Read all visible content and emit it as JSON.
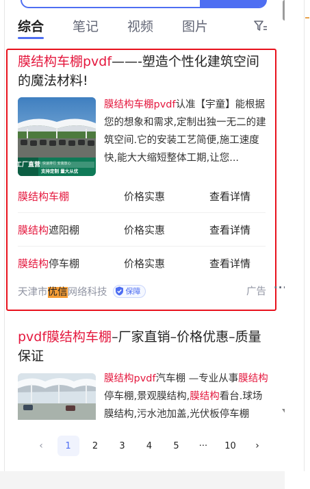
{
  "tabs": [
    {
      "label": "综合",
      "active": true
    },
    {
      "label": "笔记",
      "active": false
    },
    {
      "label": "视频",
      "active": false
    },
    {
      "label": "图片",
      "active": false
    }
  ],
  "ad": {
    "title_hl": "膜结构车棚pvdf",
    "title_rest": "——-塑造个性化建筑空间的魔法材料!",
    "thumb_banner_big": "工厂直营",
    "thumb_banner_small_1": "快速排行 安装放心",
    "thumb_banner_small_2": "支持定制 量大从优",
    "desc_hl": "膜结构车棚pvdf",
    "desc_rest": "认准【宇童】能根据您的想象和需求,定制出独一无二的建筑空间.它的安装工艺简便,施工速度快,能大大缩短整体工期,让您...",
    "rows": [
      {
        "c1_hl": "膜结构车棚",
        "c1_rest": "",
        "c2": "价格实惠",
        "c3": "查看详情"
      },
      {
        "c1_hl": "膜结构",
        "c1_rest": "遮阳棚",
        "c2": "价格实惠",
        "c3": "查看详情"
      },
      {
        "c1_hl": "膜结构",
        "c1_rest": "停车棚",
        "c2": "价格实惠",
        "c3": "查看详情"
      }
    ],
    "source_pre": "天津市",
    "source_mark": "优信",
    "source_post": "网络科技",
    "badge": "保障",
    "ad_label": "广告",
    "more": "···"
  },
  "result2": {
    "title_hl": "pvdf膜结构车棚",
    "title_rest": "–厂家直销–价格优惠–质量保证",
    "desc_hl1": "膜结构pvdf",
    "desc_mid1": "汽车棚 —专业从事",
    "desc_hl2": "膜结构",
    "desc_mid2": "停车棚,景观膜结构,",
    "desc_hl3": "膜结构",
    "desc_rest": "看台.球场膜结构,污水池加盖,光伏板停车棚"
  },
  "pagination": {
    "prev": "‹",
    "pages": [
      "1",
      "2",
      "3",
      "4",
      "5",
      "···",
      "10"
    ],
    "current": "1",
    "next": "›"
  },
  "colors": {
    "accent": "#4e6ef2",
    "highlight": "#e4173d",
    "ad_border": "#e8101b",
    "mark": "#f59d36"
  }
}
